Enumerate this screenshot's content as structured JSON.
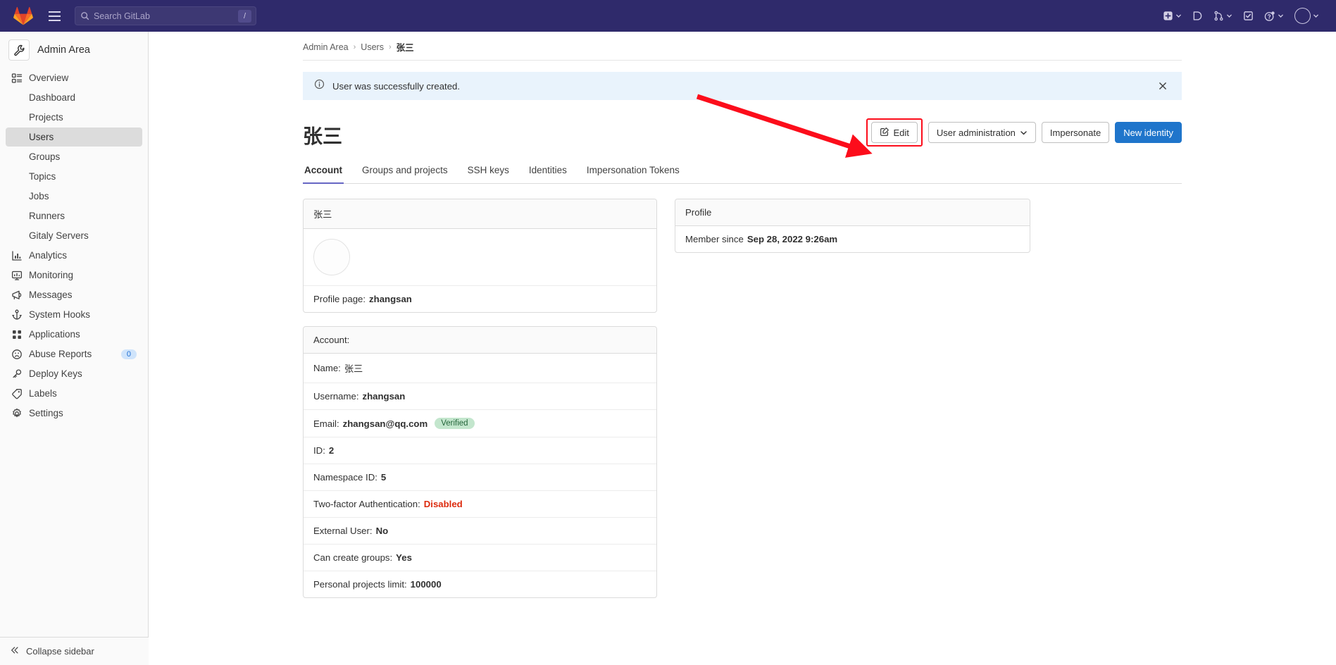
{
  "topbar": {
    "logo_icon": "gitlab-logo",
    "menu_icon": "hamburger-menu-icon",
    "search": {
      "placeholder": "Search GitLab",
      "value": "",
      "shortcut_key": "/",
      "icon": "search-icon"
    },
    "right_items": [
      {
        "name": "create-new-menu",
        "icon": "plus-square-icon",
        "has_chevron": true
      },
      {
        "name": "issues-link",
        "icon": "issues-icon",
        "has_chevron": false
      },
      {
        "name": "merge-requests-menu",
        "icon": "merge-request-icon",
        "has_chevron": true
      },
      {
        "name": "todos-link",
        "icon": "todo-check-icon",
        "has_chevron": false
      },
      {
        "name": "help-menu",
        "icon": "question-circle-icon",
        "has_chevron": true
      },
      {
        "name": "user-menu",
        "icon": "avatar-icon",
        "has_chevron": true
      }
    ]
  },
  "sidebar": {
    "context_title": "Admin Area",
    "context_icon": "wrench-icon",
    "items": [
      {
        "label": "Overview",
        "icon": "overview-icon",
        "sub": false,
        "active": false
      },
      {
        "label": "Dashboard",
        "icon": "",
        "sub": true,
        "active": false
      },
      {
        "label": "Projects",
        "icon": "",
        "sub": true,
        "active": false
      },
      {
        "label": "Users",
        "icon": "",
        "sub": true,
        "active": true
      },
      {
        "label": "Groups",
        "icon": "",
        "sub": true,
        "active": false
      },
      {
        "label": "Topics",
        "icon": "",
        "sub": true,
        "active": false
      },
      {
        "label": "Jobs",
        "icon": "",
        "sub": true,
        "active": false
      },
      {
        "label": "Runners",
        "icon": "",
        "sub": true,
        "active": false
      },
      {
        "label": "Gitaly Servers",
        "icon": "",
        "sub": true,
        "active": false
      },
      {
        "label": "Analytics",
        "icon": "chart-icon",
        "sub": false,
        "active": false
      },
      {
        "label": "Monitoring",
        "icon": "monitor-icon",
        "sub": false,
        "active": false
      },
      {
        "label": "Messages",
        "icon": "megaphone-icon",
        "sub": false,
        "active": false
      },
      {
        "label": "System Hooks",
        "icon": "anchor-icon",
        "sub": false,
        "active": false
      },
      {
        "label": "Applications",
        "icon": "applications-grid-icon",
        "sub": false,
        "active": false
      },
      {
        "label": "Abuse Reports",
        "icon": "frown-face-icon",
        "sub": false,
        "active": false,
        "badge": "0"
      },
      {
        "label": "Deploy Keys",
        "icon": "key-icon",
        "sub": false,
        "active": false
      },
      {
        "label": "Labels",
        "icon": "label-tag-icon",
        "sub": false,
        "active": false
      },
      {
        "label": "Settings",
        "icon": "gear-icon",
        "sub": false,
        "active": false
      }
    ],
    "collapse_label": "Collapse sidebar",
    "collapse_icon": "chevron-double-left-icon"
  },
  "breadcrumb": [
    {
      "label": "Admin Area"
    },
    {
      "label": "Users"
    },
    {
      "label": "张三"
    }
  ],
  "alert": {
    "message": "User was successfully created.",
    "icon": "info-circle-icon",
    "close_icon": "close-icon",
    "background": "#e9f3fc"
  },
  "page": {
    "title": "张三",
    "actions": {
      "edit_label": "Edit",
      "edit_icon": "pencil-square-icon",
      "user_administration_label": "User administration",
      "user_administration_icon": "chevron-down-icon",
      "impersonate_label": "Impersonate",
      "new_identity_label": "New identity",
      "primary_color": "#1f75cb",
      "highlight_color": "#fc0d1b"
    }
  },
  "tabs": [
    {
      "label": "Account",
      "active": true
    },
    {
      "label": "Groups and projects",
      "active": false
    },
    {
      "label": "SSH keys",
      "active": false
    },
    {
      "label": "Identities",
      "active": false
    },
    {
      "label": "Impersonation Tokens",
      "active": false
    }
  ],
  "profile_card": {
    "header": "张三",
    "avatar_icon": "user-avatar-placeholder",
    "profile_page_label": "Profile page:",
    "profile_page_value": "zhangsan"
  },
  "account_card": {
    "header": "Account:",
    "rows": [
      {
        "label": "Name:",
        "value": "张三",
        "style": "plain"
      },
      {
        "label": "Username:",
        "value": "zhangsan",
        "style": "bold"
      },
      {
        "label": "Email:",
        "value": "zhangsan@qq.com",
        "style": "bold",
        "badge": "Verified"
      },
      {
        "label": "ID:",
        "value": "2",
        "style": "bold"
      },
      {
        "label": "Namespace ID:",
        "value": "5",
        "style": "bold"
      },
      {
        "label": "Two-factor Authentication:",
        "value": "Disabled",
        "style": "danger"
      },
      {
        "label": "External User:",
        "value": "No",
        "style": "bold"
      },
      {
        "label": "Can create groups:",
        "value": "Yes",
        "style": "bold"
      },
      {
        "label": "Personal projects limit:",
        "value": "100000",
        "style": "bold"
      }
    ]
  },
  "profile_panel": {
    "header": "Profile",
    "member_since_label": "Member since",
    "member_since_value": "Sep 28, 2022 9:26am"
  }
}
